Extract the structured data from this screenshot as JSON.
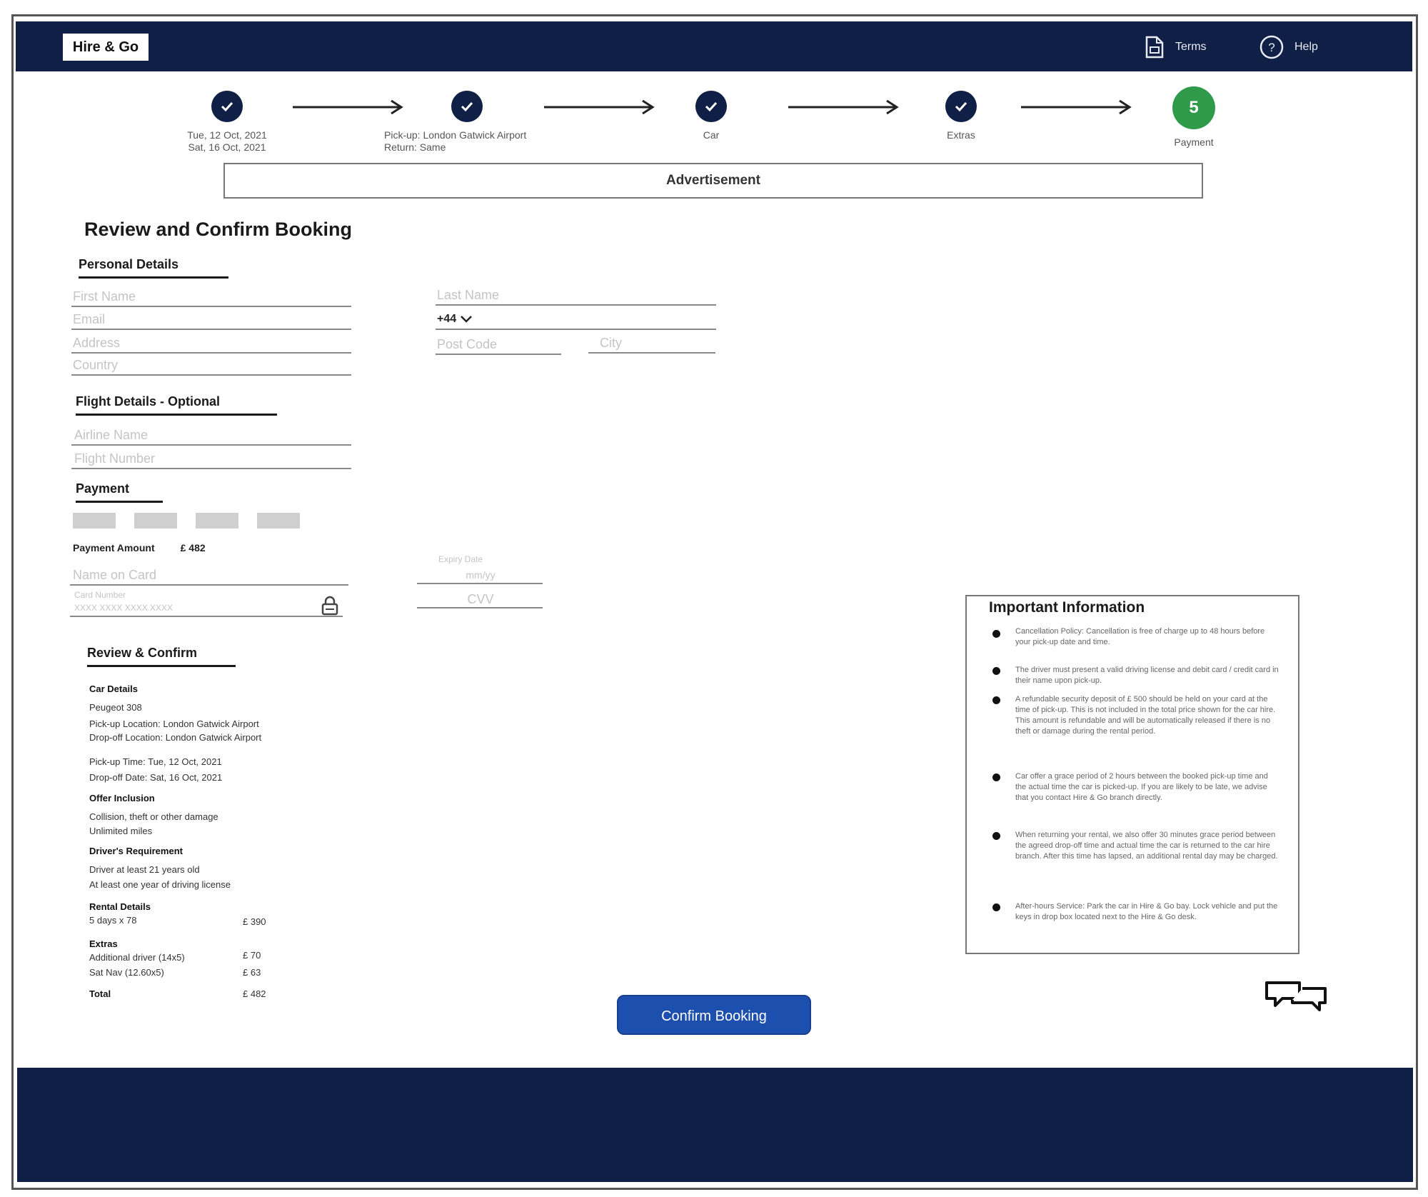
{
  "header": {
    "logo": "Hire & Go",
    "terms_label": "Terms",
    "help_label": "Help"
  },
  "steps": [
    {
      "label_line1": "Tue, 12 Oct, 2021",
      "label_line2": "Sat, 16 Oct, 2021",
      "state": "done"
    },
    {
      "label_line1": "Pick-up: London Gatwick Airport",
      "label_line2": "Return: Same",
      "state": "done"
    },
    {
      "label_line1": "Car",
      "label_line2": "",
      "state": "done"
    },
    {
      "label_line1": "Extras",
      "label_line2": "",
      "state": "done"
    },
    {
      "label_line1": "Payment",
      "label_line2": "",
      "state": "active",
      "number": "5"
    }
  ],
  "advertisement": "Advertisement",
  "page_title": "Review and Confirm Booking",
  "personal": {
    "heading": "Personal Details",
    "first_name": "First Name",
    "last_name": "Last Name",
    "email": "Email",
    "phone_prefix": "+44",
    "address": "Address",
    "post_code": "Post Code",
    "city": "City",
    "country": "Country"
  },
  "flight": {
    "heading": "Flight Details - Optional",
    "airline": "Airline Name",
    "flight_number": "Flight Number"
  },
  "payment": {
    "heading": "Payment",
    "amount_label": "Payment Amount",
    "amount_value": "£ 482",
    "name_on_card": "Name on Card",
    "card_number_label": "Card Number",
    "card_number_placeholder": "XXXX XXXX XXXX XXXX",
    "expiry_label": "Expiry Date",
    "expiry_placeholder": "mm/yy",
    "cvv": "CVV"
  },
  "review": {
    "heading": "Review & Confirm",
    "car_details_title": "Car Details",
    "car_model": "Peugeot 308",
    "pickup_location": "Pick-up Location: London Gatwick Airport",
    "dropoff_location": "Drop-off Location: London Gatwick Airport",
    "pickup_time": "Pick-up Time: Tue, 12 Oct, 2021",
    "dropoff_date": "Drop-off Date: Sat, 16 Oct, 2021",
    "offer_title": "Offer Inclusion",
    "offer_1": "Collision, theft or other damage",
    "offer_2": "Unlimited miles",
    "driver_title": "Driver's Requirement",
    "driver_1": "Driver at least 21 years old",
    "driver_2": "At least one year of driving license",
    "rental_title": "Rental Details",
    "rental_line": "5 days x 78",
    "rental_amount": "£ 390",
    "extras_title": "Extras",
    "extra_1": "Additional driver (14x5)",
    "extra_1_amount": "£ 70",
    "extra_2": "Sat Nav (12.60x5)",
    "extra_2_amount": "£ 63",
    "total_label": "Total",
    "total_amount": "£ 482"
  },
  "important": {
    "title": "Important Information",
    "items": [
      "Cancellation Policy: Cancellation is free of charge up to 48 hours before your pick-up date and time.",
      "The driver must present a valid driving license and debit card / credit card in their name upon pick-up.",
      "A refundable security deposit of £ 500 should be held on your card at the time of pick-up. This is not included in the total price shown for the car hire. This amount is refundable and will be automatically released if there is no theft or damage during the rental period.",
      "Car offer a grace period of 2 hours between the booked pick-up time and the actual time the car is picked-up. If you are likely to be late, we advise that you contact Hire & Go branch directly.",
      "When returning your rental, we also offer 30 minutes grace period between the agreed drop-off time and actual time the car is returned to the car hire branch. After this time has lapsed, an additional rental day may be charged.",
      "After-hours Service: Park the car in Hire & Go bay. Lock vehicle and put the keys in drop box located next to the Hire & Go desk."
    ]
  },
  "confirm_button": "Confirm Booking",
  "colors": {
    "navy": "#0f1f45",
    "step_active": "#2e9a4a",
    "button_blue": "#1d4fae"
  }
}
